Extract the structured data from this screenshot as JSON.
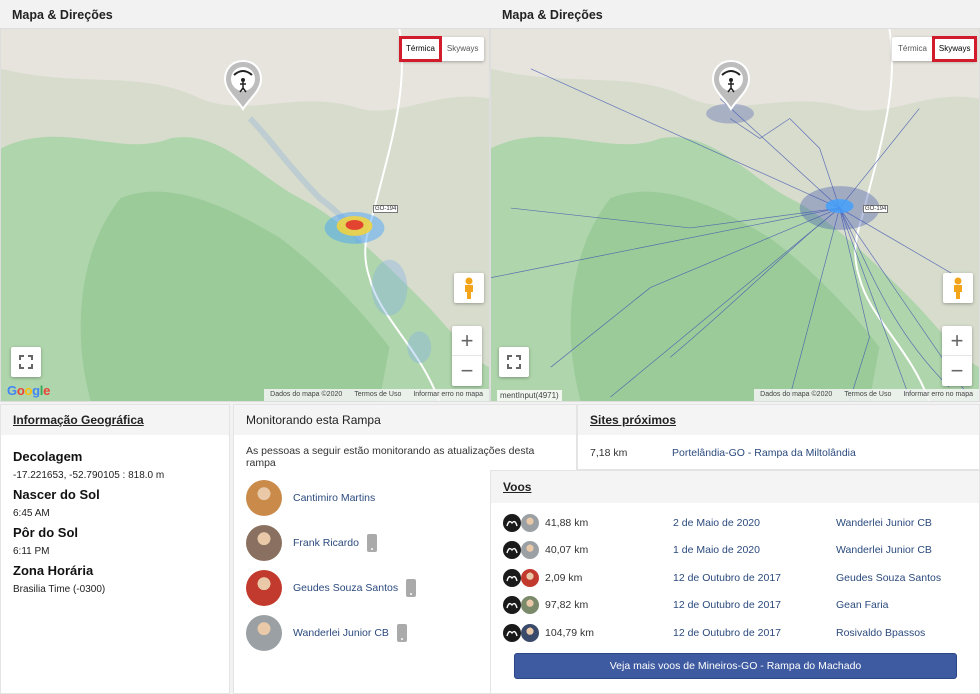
{
  "map_left": {
    "header": "Mapa & Direções",
    "toggle": {
      "thermal": "Térmica",
      "skyways": "Skyways",
      "active": "thermal"
    },
    "road_label": "GO-194",
    "footer": {
      "data": "Dados do mapa ©2020",
      "terms": "Termos de Uso",
      "report": "Informar erro no mapa"
    },
    "logo": "Google"
  },
  "map_right": {
    "header": "Mapa & Direções",
    "toggle": {
      "thermal": "Térmica",
      "skyways": "Skyways",
      "active": "skyways"
    },
    "road_label": "GO-194",
    "overlay_text": "mentInput(4971)",
    "footer": {
      "data": "Dados do mapa ©2020",
      "terms": "Termos de Uso",
      "report": "Informar erro no mapa"
    }
  },
  "zoom": {
    "plus": "+",
    "minus": "−"
  },
  "geo": {
    "title": "Informação Geográfica",
    "takeoff_label": "Decolagem",
    "takeoff_value": "-17.221653, -52.790105 : 818.0 m",
    "sunrise_label": "Nascer do Sol",
    "sunrise_value": "6:45 AM",
    "sunset_label": "Pôr do Sol",
    "sunset_value": "6:11 PM",
    "tz_label": "Zona Horária",
    "tz_value": "Brasilia Time (-0300)"
  },
  "monitor": {
    "title": "Monitorando esta Rampa",
    "desc": "As pessoas a seguir estão monitorando as atualizações desta rampa",
    "people": [
      {
        "name": "Cantimiro Martins",
        "phone": false,
        "color": "#c98a4a"
      },
      {
        "name": "Frank Ricardo",
        "phone": true,
        "color": "#8a7060"
      },
      {
        "name": "Geudes Souza Santos",
        "phone": true,
        "color": "#c23a2e"
      },
      {
        "name": "Wanderlei Junior CB",
        "phone": true,
        "color": "#9aa0a4"
      }
    ]
  },
  "sites": {
    "title": "Sites próximos",
    "items": [
      {
        "distance": "7,18 km",
        "name": "Portelândia-GO - Rampa da Miltolândia"
      }
    ]
  },
  "voos": {
    "title": "Voos",
    "rows": [
      {
        "distance": "41,88 km",
        "date": "2 de Maio de 2020",
        "pilot": "Wanderlei Junior CB",
        "color": "#9aa0a4"
      },
      {
        "distance": "40,07 km",
        "date": "1 de Maio de 2020",
        "pilot": "Wanderlei Junior CB",
        "color": "#9aa0a4"
      },
      {
        "distance": "2,09 km",
        "date": "12 de Outubro de 2017",
        "pilot": "Geudes Souza Santos",
        "color": "#c23a2e"
      },
      {
        "distance": "97,82 km",
        "date": "12 de Outubro de 2017",
        "pilot": "Gean Faria",
        "color": "#7a8a6a"
      },
      {
        "distance": "104,79 km",
        "date": "12 de Outubro de 2017",
        "pilot": "Rosivaldo Bpassos",
        "color": "#3a4a6a"
      }
    ],
    "more_button": "Veja mais voos de Mineiros-GO - Rampa do Machado"
  }
}
